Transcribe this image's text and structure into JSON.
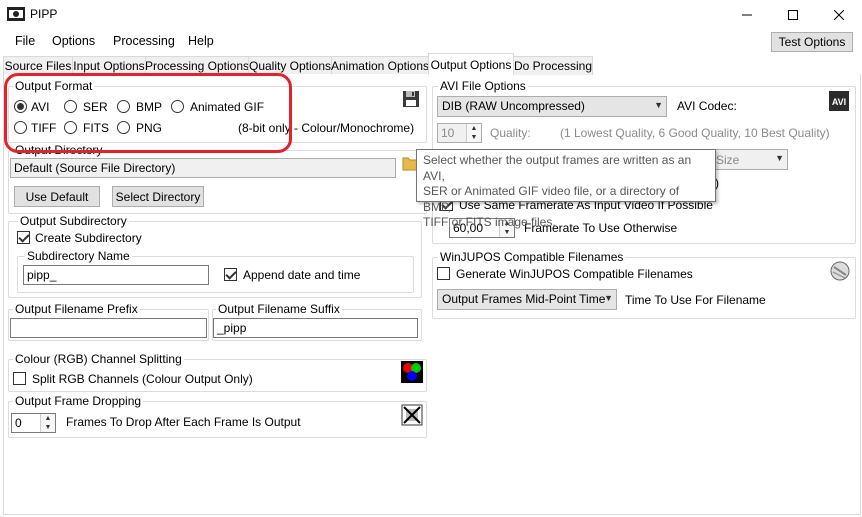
{
  "window": {
    "title": "PIPP",
    "minimize_icon": "minimize-icon",
    "maximize_icon": "maximize-icon",
    "close_icon": "close-icon"
  },
  "menu": {
    "items": [
      "File",
      "Options",
      "Processing",
      "Help"
    ],
    "test_options": "Test Options"
  },
  "tabs": [
    "Source Files",
    "Input Options",
    "Processing Options",
    "Quality Options",
    "Animation Options",
    "Output Options",
    "Do Processing"
  ],
  "active_tab": "Output Options",
  "output_format": {
    "title": "Output Format",
    "options": [
      "AVI",
      "SER",
      "BMP",
      "Animated GIF",
      "TIFF",
      "FITS",
      "PNG"
    ],
    "selected": "AVI",
    "note": "(8-bit only - Colour/Monochrome)",
    "save_icon": "floppy-disk-icon"
  },
  "output_directory": {
    "title": "Output Directory",
    "value": "Default (Source File Directory)",
    "use_default": "Use Default",
    "select_directory": "Select Directory",
    "folder_icon": "folder-icon"
  },
  "output_subdirectory": {
    "title": "Output Subdirectory",
    "create_label": "Create Subdirectory",
    "create_checked": true,
    "name_title": "Subdirectory Name",
    "name_value": "pipp_",
    "append_label": "Append date and time",
    "append_checked": true
  },
  "filename_prefix": {
    "title": "Output Filename Prefix",
    "value": ""
  },
  "filename_suffix": {
    "title": "Output Filename Suffix",
    "value": "_pipp"
  },
  "rgb_split": {
    "title": "Colour (RGB) Channel Splitting",
    "label": "Split RGB Channels (Colour Output Only)",
    "checked": false,
    "icon": "rgb-circles-icon"
  },
  "frame_dropping": {
    "title": "Output Frame Dropping",
    "value": "0",
    "label": "Frames To Drop After Each Frame Is Output",
    "icon": "drop-frame-icon"
  },
  "avi_options": {
    "title": "AVI File Options",
    "codec_value": "DIB (RAW Uncompressed)",
    "codec_label": "AVI Codec:",
    "quality_value": "10",
    "quality_label": "Quality:",
    "quality_hint": "(1 Lowest Quality, 6 Good Quality, 10 Best Quality)",
    "size_partial": "Size",
    "paren_partial": ")",
    "framerate_label": "Use Same Framerate As Input Video If Possible",
    "framerate_checked": true,
    "framerate_value": "60,00",
    "framerate_other": "Framerate To Use Otherwise",
    "avi_icon": "avi-icon"
  },
  "winjupos": {
    "title": "WinJUPOS Compatible Filenames",
    "generate_label": "Generate WinJUPOS Compatible Filenames",
    "generate_checked": false,
    "time_value": "Output Frames Mid-Point Time",
    "time_label": "Time To Use For Filename",
    "icon": "jupiter-icon"
  },
  "tooltip": {
    "line1": "Select whether the output frames are written as an AVI,",
    "line2": "SER or Animated GIF video file, or a directory of BMP,",
    "line3": "TIFF or FITS image files."
  },
  "colors": {
    "highlight": "#e0242a",
    "window_bg": "#ffffff",
    "tab_border": "#d9d9d9"
  }
}
